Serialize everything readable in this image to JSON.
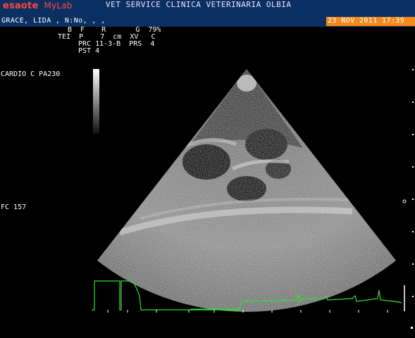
{
  "header": {
    "brand_main": "esaote",
    "brand_sub": "MyLab",
    "clinic": "VET SERVICE CLINICA VETERINARIA OLBIA",
    "patient": "GRACE, LIDA , N:No, , ,",
    "datetime": "23 NOV 2011 17:39"
  },
  "params": {
    "row1": "B  F    R       G  79%",
    "row2": "TEI  P    7  cm  XV   C",
    "row3": "PRC 11-3-B  PRS  4",
    "row4": "PST 4"
  },
  "sidebar": {
    "probe_mode": "CARDIO C PA230",
    "heart_rate": "FC 157"
  },
  "colors": {
    "header_bg": "#0b2f63",
    "date_bg": "#f08a1c",
    "ecg": "#33dd33",
    "ecg_marker": "#ffffff"
  }
}
